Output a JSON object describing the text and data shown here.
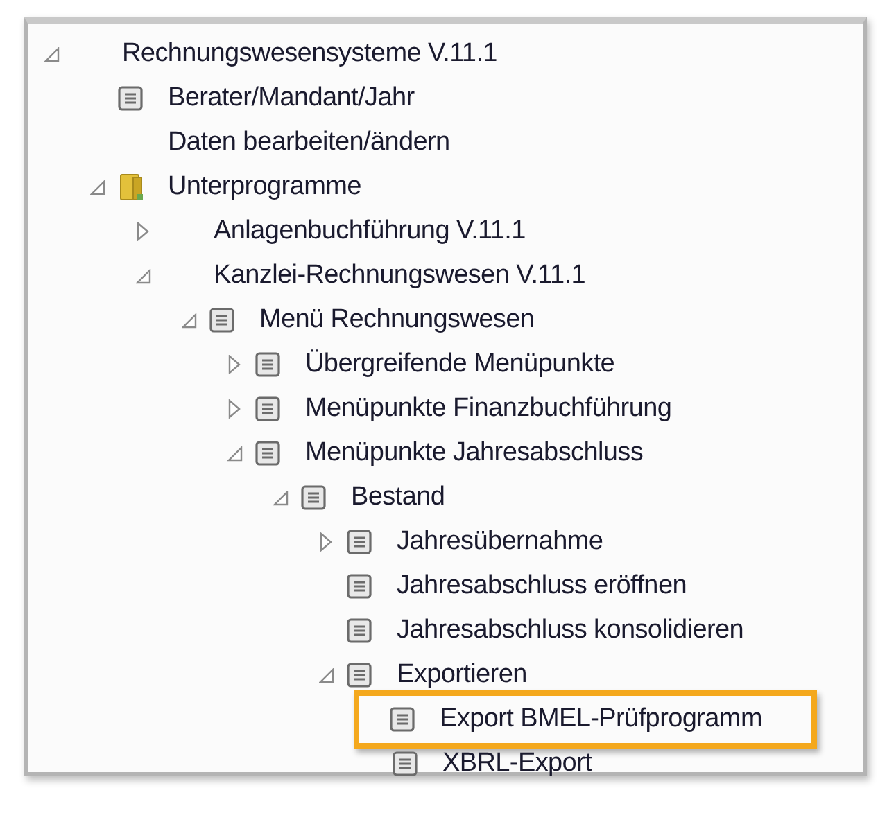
{
  "tree": [
    {
      "label": "Rechnungswesensysteme V.11.1",
      "expanded": true,
      "selected": false,
      "children": [
        {
          "label": "Berater/Mandant/Jahr",
          "kind": "document",
          "selected": false
        },
        {
          "label": "Daten bearbeiten/ändern",
          "selected": false
        },
        {
          "label": "Unterprogramme",
          "kind": "folder",
          "expanded": true,
          "selected": false,
          "children": [
            {
              "label": "Anlagenbuchführung V.11.1",
              "expanded": false,
              "selected": false
            },
            {
              "label": "Kanzlei-Rechnungswesen V.11.1",
              "expanded": true,
              "selected": false,
              "children": [
                {
                  "label": "Menü Rechnungswesen",
                  "kind": "document",
                  "expanded": true,
                  "selected": false,
                  "children": [
                    {
                      "label": "Übergreifende Menüpunkte",
                      "kind": "document",
                      "expanded": false,
                      "selected": false
                    },
                    {
                      "label": "Menüpunkte Finanzbuchführung",
                      "kind": "document",
                      "expanded": false,
                      "selected": false
                    },
                    {
                      "label": "Menüpunkte Jahresabschluss",
                      "kind": "document",
                      "expanded": true,
                      "selected": false,
                      "children": [
                        {
                          "label": "Bestand",
                          "kind": "document",
                          "expanded": true,
                          "selected": false,
                          "children": [
                            {
                              "label": "Jahresübernahme",
                              "kind": "document",
                              "expanded": false,
                              "selected": false
                            },
                            {
                              "label": "Jahresabschluss eröffnen",
                              "kind": "document",
                              "selected": false
                            },
                            {
                              "label": "Jahresabschluss konsolidieren",
                              "kind": "document",
                              "selected": false
                            },
                            {
                              "label": "Exportieren",
                              "kind": "document",
                              "expanded": true,
                              "selected": false,
                              "children": [
                                {
                                  "label": "Export BMEL-Prüfprogramm",
                                  "kind": "document",
                                  "selected": true
                                },
                                {
                                  "label": "XBRL-Export",
                                  "kind": "document",
                                  "selected": false
                                }
                              ]
                            }
                          ]
                        }
                      ]
                    }
                  ]
                }
              ]
            }
          ]
        }
      ]
    }
  ]
}
